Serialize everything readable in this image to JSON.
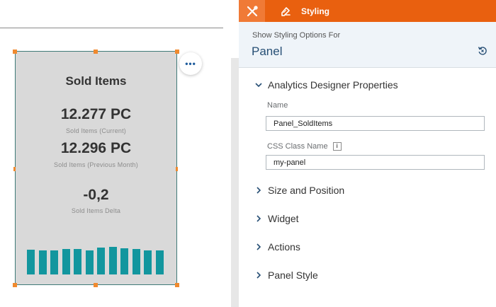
{
  "widget": {
    "title": "Sold Items",
    "current_value": "12.277 PC",
    "current_caption": "Sold Items (Current)",
    "previous_value": "12.296 PC",
    "previous_caption": "Sold Items (Previous Month)",
    "delta_value": "-0,2",
    "delta_caption": "Sold Items Delta",
    "bar_color": "#12969e",
    "bar_levels": [
      0.84,
      0.8,
      0.8,
      0.86,
      0.86,
      0.82,
      0.9,
      0.93,
      0.88,
      0.86,
      0.82,
      0.82
    ]
  },
  "more_button": {
    "icon": "more-dots-icon",
    "glyph": "•••"
  },
  "panel": {
    "tabs": [
      {
        "icon": "designer-tools-icon"
      },
      {
        "icon": "paint-brush-icon",
        "label": "Styling"
      }
    ],
    "header": {
      "label": "Show Styling Options For",
      "value": "Panel",
      "reset_icon": "reset-icon"
    },
    "sections": {
      "analytics": "Analytics Designer Properties",
      "size_position": "Size and Position",
      "widget": "Widget",
      "actions": "Actions",
      "panel_style": "Panel Style"
    },
    "fields": {
      "name_label": "Name",
      "name_value": "Panel_SoldItems",
      "css_label": "CSS Class Name",
      "css_value": "my-panel",
      "info_glyph": "i"
    }
  },
  "colors": {
    "accent": "#e9600f",
    "accent_light": "#f07a36",
    "widget_border": "#3f7a78",
    "handle": "#f08a2f",
    "title_blue": "#274f75"
  }
}
